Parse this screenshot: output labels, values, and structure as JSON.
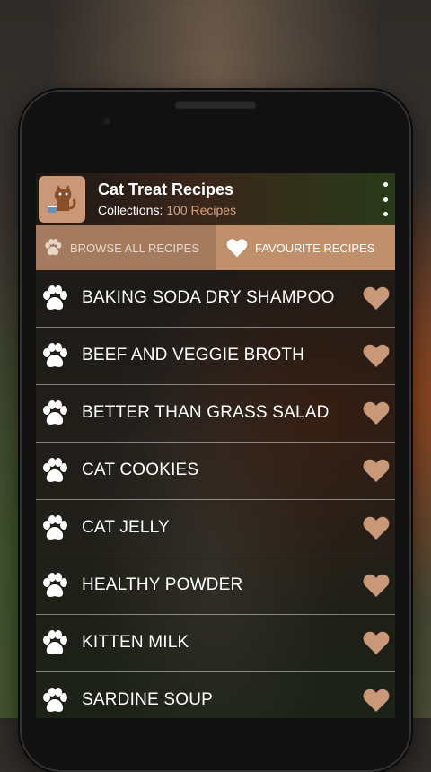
{
  "app": {
    "title": "Cat Treat Recipes",
    "collections_label": "Collections:",
    "collections_count": "100 Recipes"
  },
  "tabs": {
    "browse_label": "BROWSE ALL RECIPES",
    "favourite_label": "FAVOURITE RECIPES"
  },
  "recipes": [
    {
      "label": "BAKING SODA DRY SHAMPOO"
    },
    {
      "label": "BEEF AND VEGGIE BROTH"
    },
    {
      "label": "BETTER THAN GRASS SALAD"
    },
    {
      "label": "CAT COOKIES"
    },
    {
      "label": "CAT JELLY"
    },
    {
      "label": "HEALTHY POWDER"
    },
    {
      "label": "KITTEN MILK"
    },
    {
      "label": "SARDINE SOUP"
    }
  ],
  "colors": {
    "accent": "#c0906c",
    "accent_dark": "#a47b5e",
    "heart": "#c89878",
    "count_text": "#d7a37f"
  },
  "icons": {
    "row_icon": "paw-icon",
    "favorite_icon": "heart-icon",
    "menu_icon": "overflow-menu-icon"
  }
}
